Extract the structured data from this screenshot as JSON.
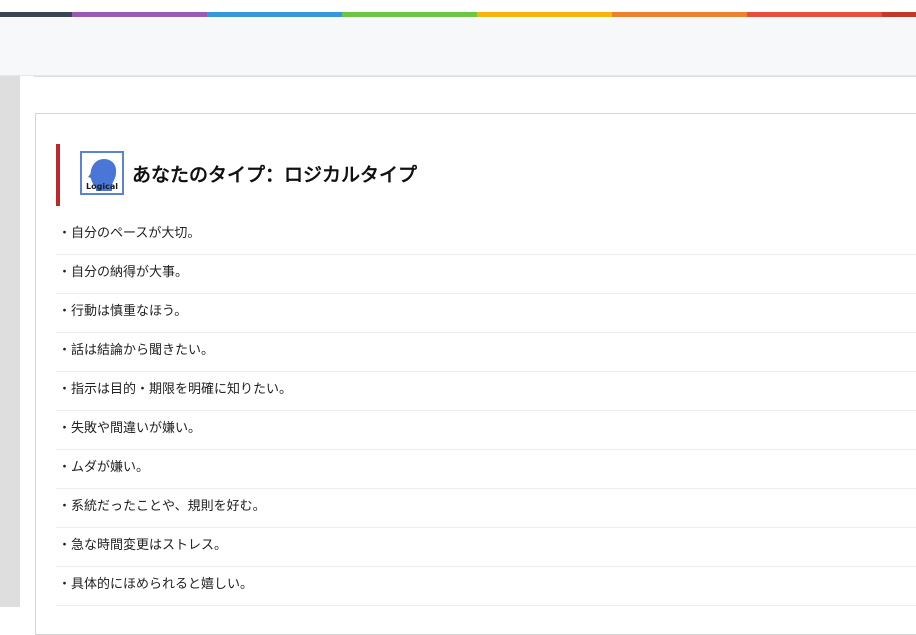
{
  "color_bar": {
    "colors": [
      "#3a4654",
      "#9b59b6",
      "#3498db",
      "#6cc644",
      "#f5b50c",
      "#ec8230",
      "#e74c3c",
      "#c0392b"
    ]
  },
  "type_section": {
    "avatar_label": "Logical",
    "title": "あなたのタイプ：ロジカルタイプ",
    "accent_color": "#c0272d",
    "avatar_color": "#4a76d8"
  },
  "traits": [
    "・自分のペースが大切。",
    "・自分の納得が大事。",
    "・行動は慎重なほう。",
    "・話は結論から聞きたい。",
    "・指示は目的・期限を明確に知りたい。",
    "・失敗や間違いが嫌い。",
    "・ムダが嫌い。",
    "・系統だったことや、規則を好む。",
    "・急な時間変更はストレス。",
    "・具体的にほめられると嬉しい。"
  ]
}
